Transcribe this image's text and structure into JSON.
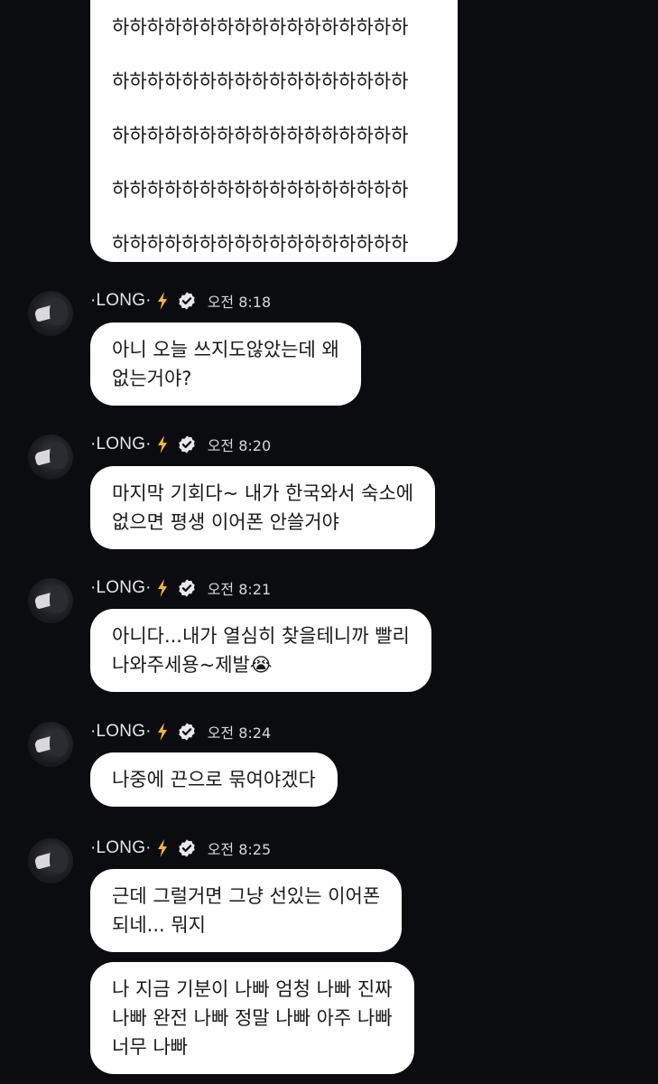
{
  "top_bubble": {
    "lines": [
      "하하하하하하하하하하하하하하하하하",
      "하하하하하하하하하하하하하하하하하",
      "하하하하하하하하하하하하하하하하하",
      "하하하하하하하하하하하하하하하하하",
      "하하하하하하하하하하하하하하하하하"
    ]
  },
  "sender": {
    "name": "·LONG·",
    "bolt_color": "#f2b441",
    "verified_color": "#e8e8e8"
  },
  "messages": [
    {
      "time": "오전 8:18",
      "bubbles": [
        {
          "lines": [
            "아니 오늘 쓰지도않았는데 왜",
            "없는거야?"
          ]
        }
      ]
    },
    {
      "time": "오전 8:20",
      "bubbles": [
        {
          "lines": [
            "마지막 기회다~ 내가 한국와서 숙소에",
            "없으면 평생 이어폰 안쓸거야"
          ]
        }
      ]
    },
    {
      "time": "오전 8:21",
      "bubbles": [
        {
          "lines": [
            "아니다...내가 열심히 찾을테니까 빨리",
            "나와주세용~제발😭"
          ]
        }
      ]
    },
    {
      "time": "오전 8:24",
      "bubbles": [
        {
          "lines": [
            "나중에 끈으로 묶여야겠다"
          ]
        }
      ]
    },
    {
      "time": "오전 8:25",
      "bubbles": [
        {
          "lines": [
            "근데 그럴거면 그냥 선있는 이어폰",
            "되네... 뭐지"
          ]
        },
        {
          "lines": [
            "나 지금 기분이 나빠 엄청 나빠 진짜",
            "나빠 완전 나빠 정말 나빠 아주 나빠",
            "너무 나빠"
          ]
        }
      ]
    }
  ]
}
